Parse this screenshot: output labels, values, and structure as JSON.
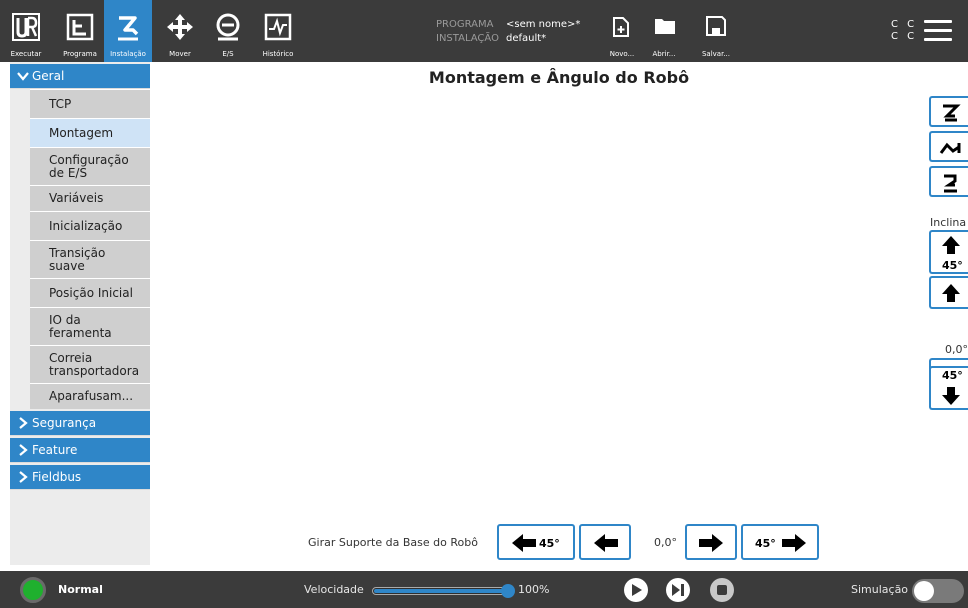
{
  "topbar": {
    "nav": [
      {
        "label": "Executar",
        "icon": "ur-logo-icon"
      },
      {
        "label": "Programa",
        "icon": "program-icon"
      },
      {
        "label": "Instalação",
        "icon": "installation-icon"
      },
      {
        "label": "Mover",
        "icon": "move-icon"
      },
      {
        "label": "E/S",
        "icon": "io-icon"
      },
      {
        "label": "Histórico",
        "icon": "log-icon"
      }
    ],
    "program_key": "PROGRAMA",
    "program_value": "<sem nome>*",
    "installation_key": "INSTALAÇÃO",
    "installation_value": "default*",
    "file_buttons": [
      {
        "label": "Novo...",
        "icon": "new-file-icon"
      },
      {
        "label": "Abrir...",
        "icon": "folder-icon"
      },
      {
        "label": "Salvar...",
        "icon": "save-icon"
      }
    ],
    "cc_top": "C C",
    "cc_bottom": "C C"
  },
  "sidebar": {
    "sections": [
      {
        "label": "Geral",
        "expanded": true
      },
      {
        "label": "Segurança",
        "expanded": false
      },
      {
        "label": "Feature",
        "expanded": false
      },
      {
        "label": "Fieldbus",
        "expanded": false
      }
    ],
    "items": [
      {
        "label": "TCP"
      },
      {
        "label": "Montagem",
        "selected": true
      },
      {
        "label": "Configuração de E/S"
      },
      {
        "label": "Variáveis"
      },
      {
        "label": "Inicialização"
      },
      {
        "label": "Transição suave"
      },
      {
        "label": "Posição Inicial"
      },
      {
        "label": "IO da feramenta"
      },
      {
        "label": "Correia transportadora"
      },
      {
        "label": "Aparafusam..."
      }
    ]
  },
  "main": {
    "title": "Montagem e Ângulo do Robô",
    "incline_label": "Inclina",
    "incline_up_45": "45°",
    "incline_value": "0,0°",
    "incline_down_45": "45°",
    "rotate_label": "Girar Suporte da Base do Robô",
    "rotate_left_45": "45°",
    "rotate_value": "0,0°",
    "rotate_right_45": "45°"
  },
  "footer": {
    "status": "Normal",
    "status_color": "#1fb02e",
    "speed_label": "Velocidade",
    "speed_value": "100%",
    "speed_fraction": 1.0,
    "simulation_label": "Simulação",
    "simulation_on": false
  },
  "colors": {
    "accent": "#2f86c8",
    "topbar": "#3b3b3b",
    "selected_item": "#cfe3f6"
  }
}
